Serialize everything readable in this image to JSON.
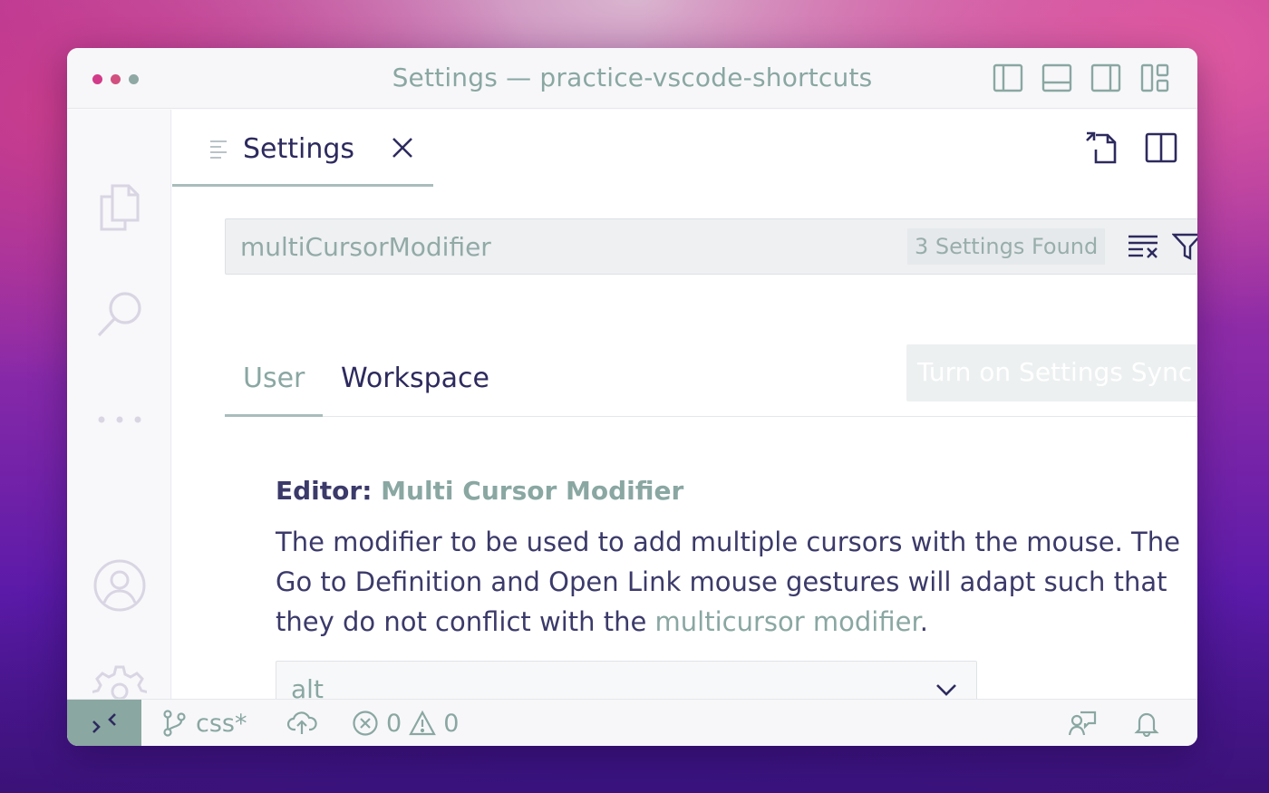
{
  "window": {
    "title": "Settings — practice-vscode-shortcuts"
  },
  "editor": {
    "tab": {
      "label": "Settings"
    },
    "search": {
      "value": "multiCursorModifier",
      "results": "3 Settings Found"
    },
    "scopes": {
      "user": "User",
      "workspace": "Workspace"
    },
    "sync_button": "Turn on Settings Sync",
    "setting": {
      "category": "Editor: ",
      "name": "Multi Cursor Modifier",
      "description_before": "The modifier to be used to add multiple cursors with the mouse. The Go to Definition and Open Link mouse gestures will adapt such that they do not conflict with the ",
      "description_link": "multicursor modifier",
      "description_after": ".",
      "value": "alt"
    }
  },
  "statusbar": {
    "branch": "css*",
    "errors": "0",
    "warnings": "0"
  },
  "icons": {
    "activity": [
      "explorer-icon",
      "search-icon",
      "more-icon",
      "account-icon",
      "settings-gear-icon"
    ],
    "layout": [
      "toggle-primary-sidebar-icon",
      "toggle-panel-icon",
      "toggle-secondary-sidebar-icon",
      "customize-layout-icon"
    ]
  },
  "colors": {
    "accent": "#8aa7a2",
    "text": "#2d2a5e"
  }
}
